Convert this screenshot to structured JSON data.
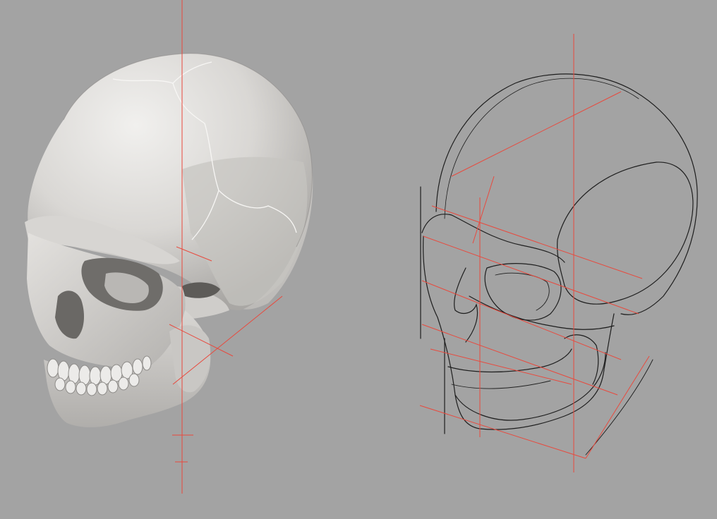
{
  "scene": {
    "background": "#a3a3a3",
    "guide_color": "#e84a3e",
    "sketch_color": "#1e1e1e",
    "bone_color": "#dad8d5",
    "left_panel": {
      "subject": "rendered-skull-3d-model",
      "view": "three-quarter"
    },
    "right_panel": {
      "subject": "skull-construction-line-sketch",
      "view": "three-quarter"
    }
  }
}
